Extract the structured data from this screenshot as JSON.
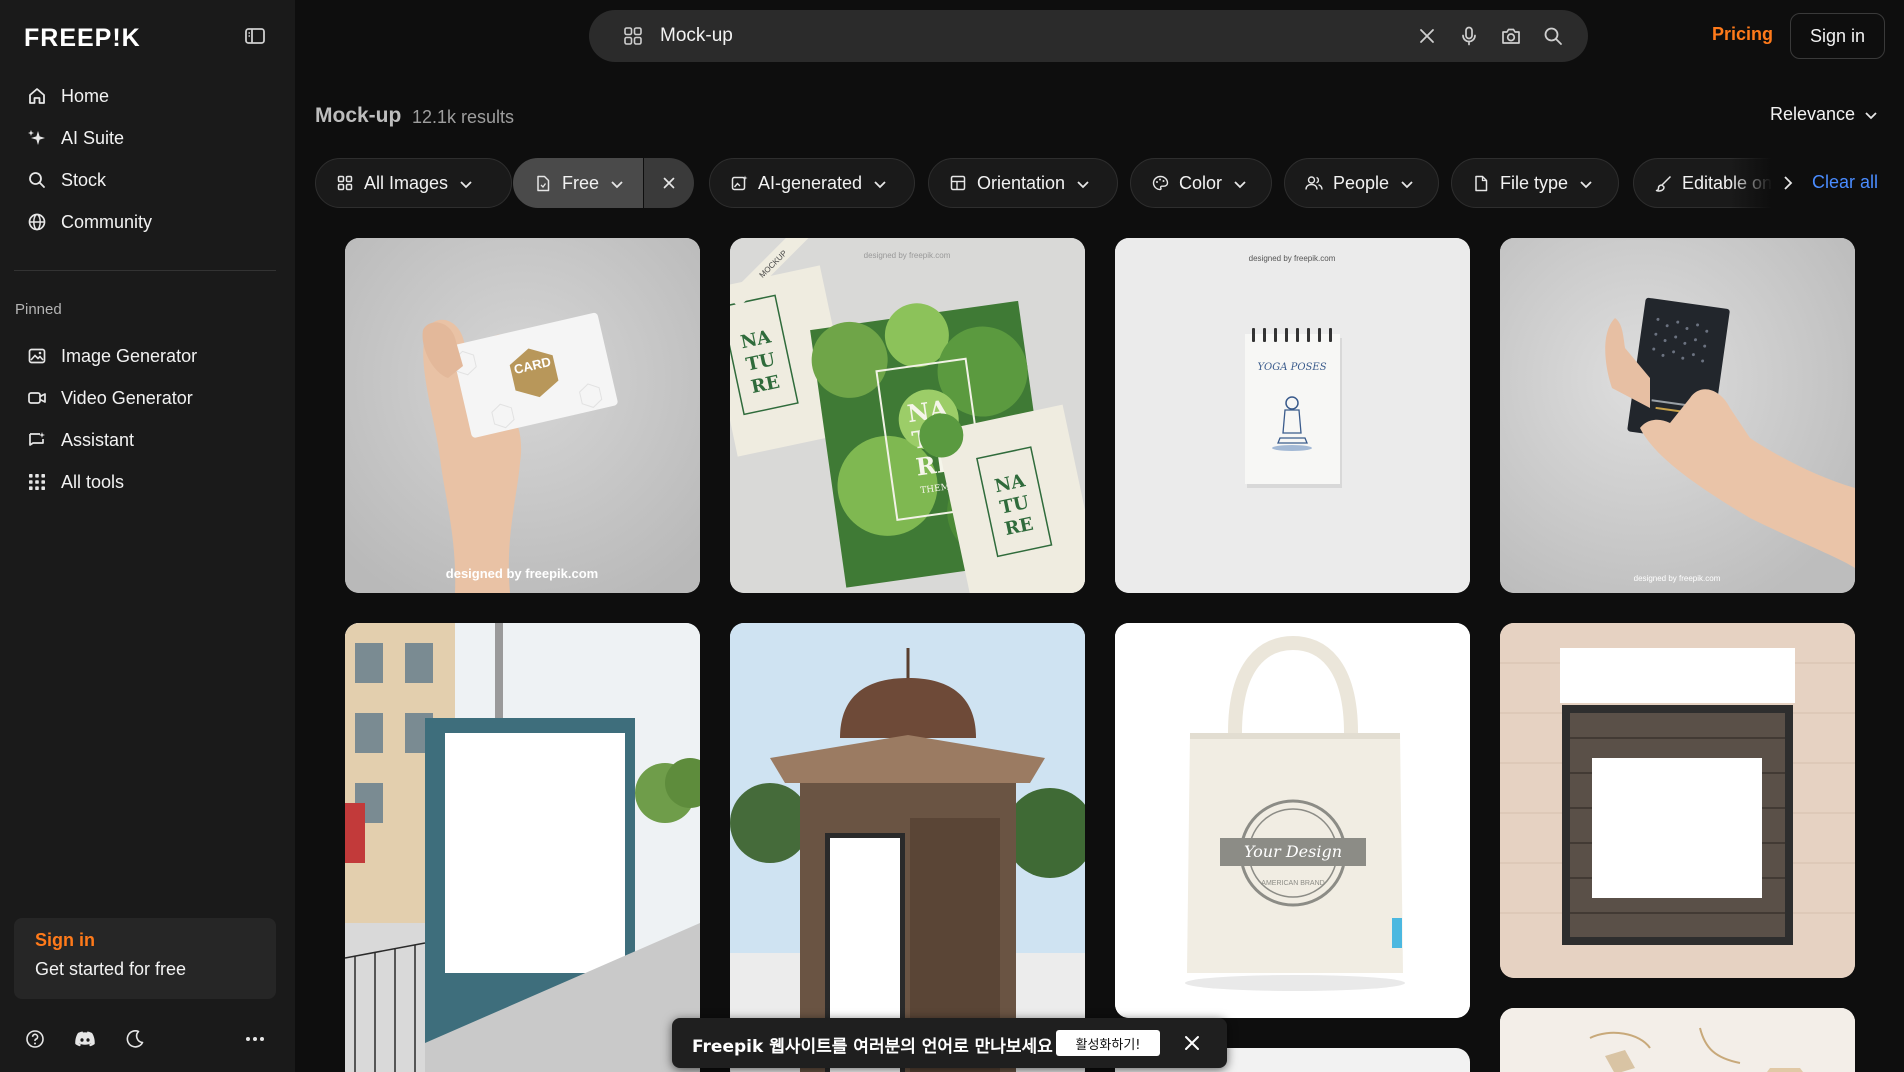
{
  "sidebar": {
    "logo": "FREEP!K",
    "main_items": [
      {
        "label": "Home",
        "icon": "home-icon"
      },
      {
        "label": "AI Suite",
        "icon": "sparkle-icon"
      },
      {
        "label": "Stock",
        "icon": "search-icon"
      },
      {
        "label": "Community",
        "icon": "globe-icon"
      }
    ],
    "pinned_label": "Pinned",
    "pinned_items": [
      {
        "label": "Image Generator",
        "icon": "image-icon"
      },
      {
        "label": "Video Generator",
        "icon": "video-icon"
      },
      {
        "label": "Assistant",
        "icon": "chat-icon"
      },
      {
        "label": "All tools",
        "icon": "grid-icon"
      }
    ],
    "signin_card": {
      "title": "Sign in",
      "subtitle": "Get started for free"
    },
    "bottom_icons": [
      "help-icon",
      "discord-icon",
      "moon-icon",
      "more-icon"
    ]
  },
  "header": {
    "search_value": "Mock-up",
    "pricing": "Pricing",
    "signin": "Sign in"
  },
  "results": {
    "title": "Mock-up",
    "count": "12.1k results",
    "sort": "Relevance"
  },
  "filters": {
    "chips": [
      {
        "label": "All Images",
        "icon": "grid-icon"
      },
      {
        "label": "Free",
        "icon": "file-icon",
        "active": true
      },
      {
        "label": "AI-generated",
        "icon": "ai-image-icon"
      },
      {
        "label": "Orientation",
        "icon": "layout-icon"
      },
      {
        "label": "Color",
        "icon": "palette-icon"
      },
      {
        "label": "People",
        "icon": "people-icon"
      },
      {
        "label": "File type",
        "icon": "file-icon"
      },
      {
        "label": "Editable online",
        "icon": "brush-icon"
      }
    ],
    "clear_all": "Clear all"
  },
  "grid": {
    "watermark": "designed by freepik.com",
    "card_text": "CARD",
    "nature_text": "NATURE",
    "theme_text": "THEME",
    "mockup_tag": "MOCKUP",
    "yoga_text": "YOGA POSES",
    "tote_text": "Your Design",
    "tote_sub": "AMERICAN BRAND"
  },
  "toast": {
    "message": "Freepik 웹사이트를 여러분의 언어로 만나보세요",
    "button": "활성화하기!"
  }
}
